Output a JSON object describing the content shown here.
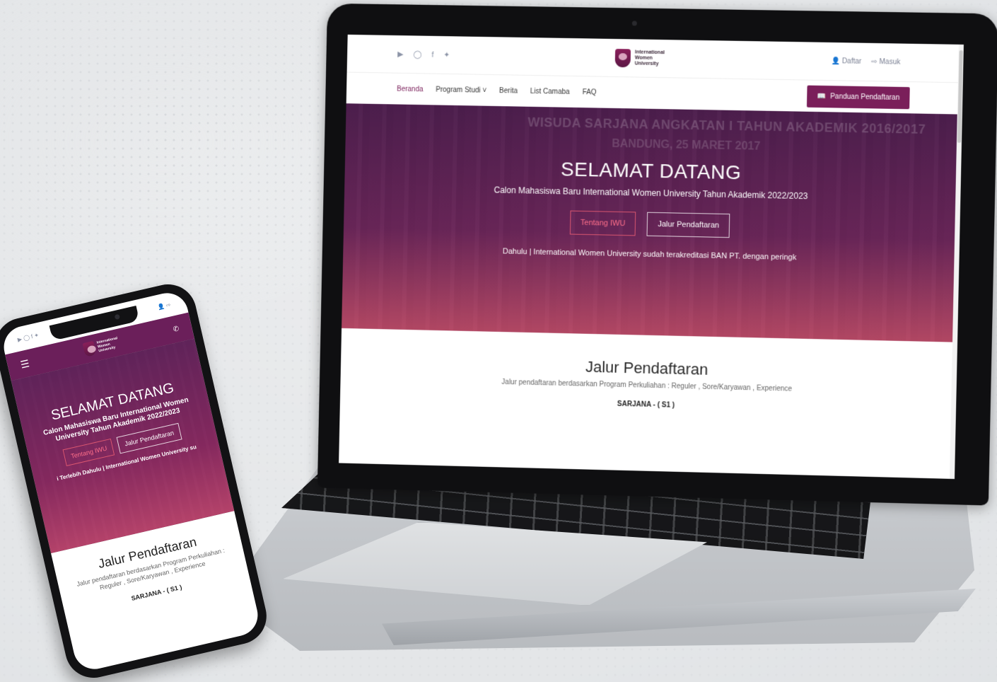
{
  "site": {
    "logo_text": "International\nWomen\nUniversity",
    "social_icons": [
      "youtube-icon",
      "instagram-icon",
      "facebook-icon",
      "twitter-icon"
    ],
    "auth": {
      "register": "Daftar",
      "login": "Masuk"
    },
    "nav": [
      "Beranda",
      "Program Studi",
      "Berita",
      "List Camaba",
      "FAQ"
    ],
    "guide_button": "Panduan Pendaftaran",
    "hero": {
      "banner_line1": "WISUDA SARJANA ANGKATAN I TAHUN AKADEMIK 2016/2017",
      "banner_line2": "BANDUNG, 25 MARET 2017",
      "title": "SELAMAT DATANG",
      "subtitle": "Calon Mahasiswa Baru International Women University Tahun Akademik 2022/2023",
      "btn_about": "Tentang IWU",
      "btn_path": "Jalur Pendaftaran",
      "ticker_laptop": "Dahulu | International Women University sudah terakreditasi BAN PT. dengan peringk",
      "ticker_phone": "i Terlebih Dahulu | International Women University su"
    },
    "section": {
      "title": "Jalur Pendaftaran",
      "description": "Jalur pendaftaran berdasarkan Program Perkuliahan : Reguler , Sore/Karyawan , Experience",
      "level": "SARJANA - ( S1 )"
    }
  },
  "colors": {
    "brand": "#7a1f5a",
    "accent_pink": "#ff6f8a"
  }
}
